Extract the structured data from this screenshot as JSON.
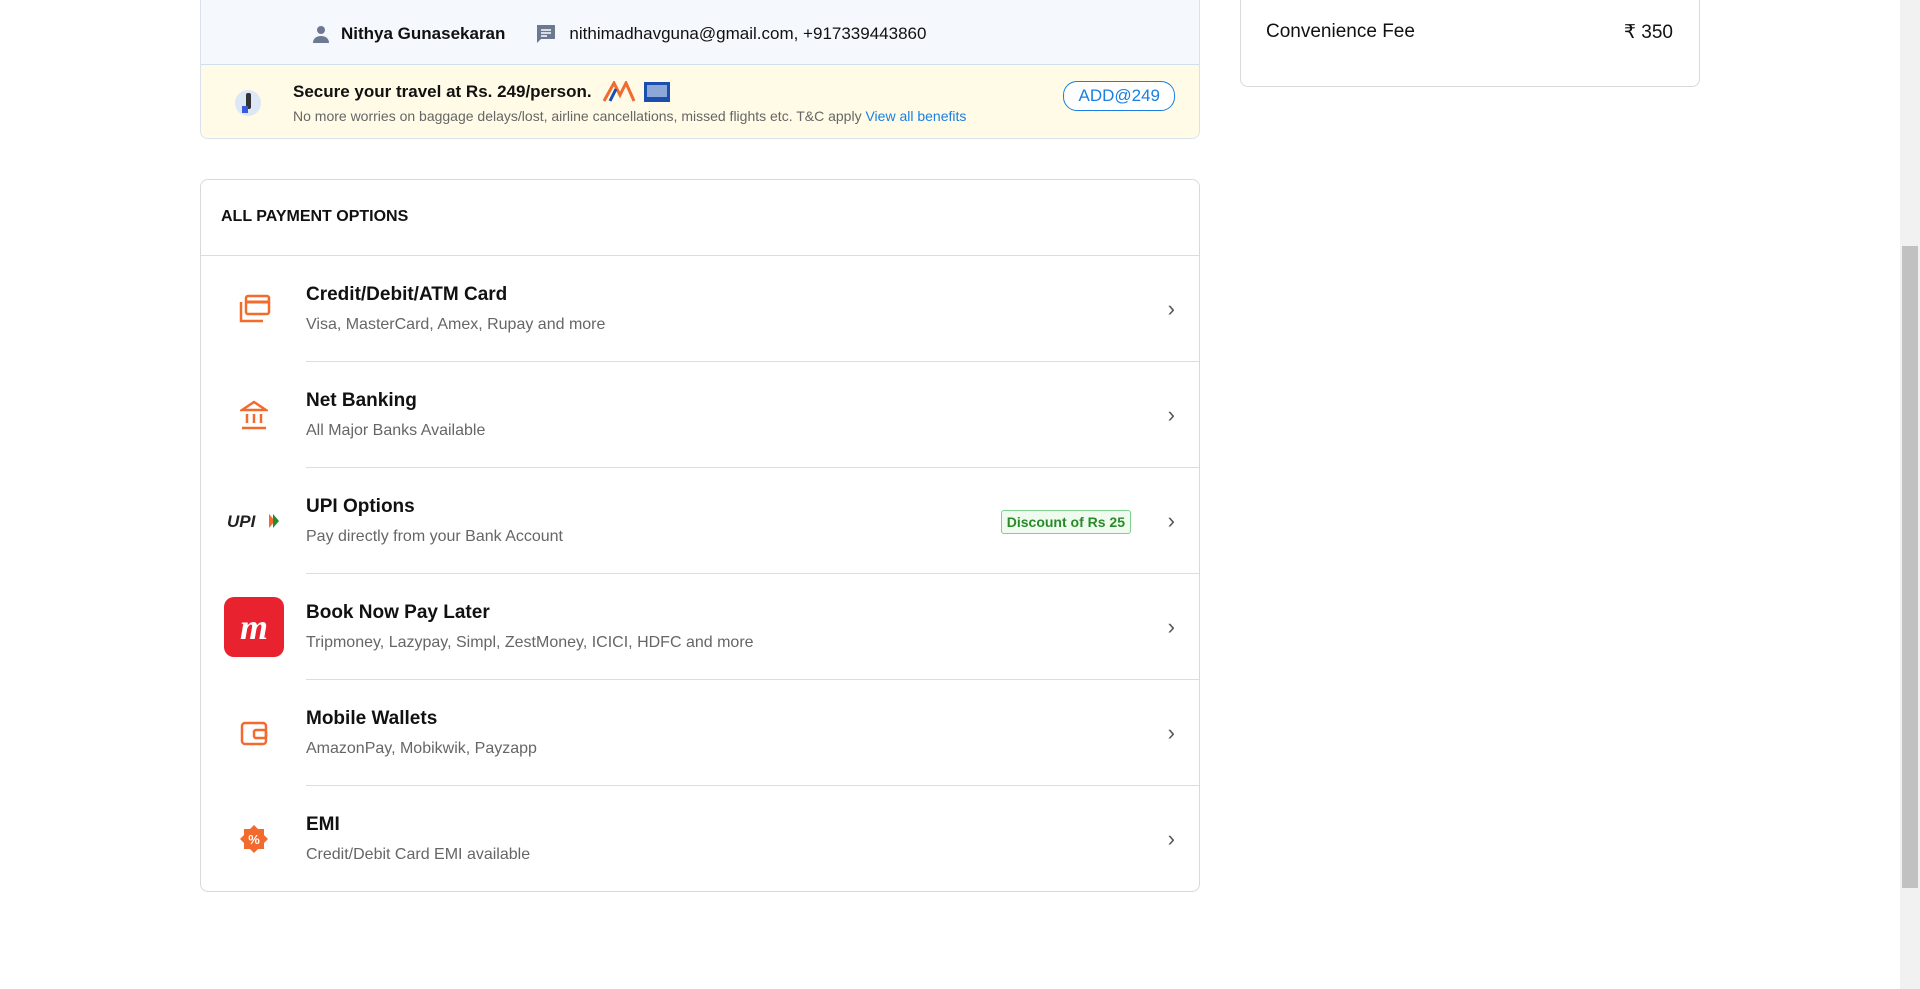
{
  "contact": {
    "name": "Nithya Gunasekaran",
    "details": "nithimadhavguna@gmail.com, +917339443860"
  },
  "insurance": {
    "title": "Secure your travel at Rs. 249/person.",
    "description": "No more worries on baggage delays/lost, airline cancellations, missed flights etc. T&C apply",
    "link": "View all benefits",
    "button": "ADD@249"
  },
  "payment": {
    "heading": "ALL PAYMENT OPTIONS",
    "options": [
      {
        "title": "Credit/Debit/ATM Card",
        "subtitle": "Visa, MasterCard, Amex, Rupay and more",
        "icon": "card-icon"
      },
      {
        "title": "Net Banking",
        "subtitle": "All Major Banks Available",
        "icon": "bank-icon"
      },
      {
        "title": "UPI Options",
        "subtitle": "Pay directly from your Bank Account",
        "icon": "upi-logo",
        "badge": "Discount of Rs 25"
      },
      {
        "title": "Book Now Pay Later",
        "subtitle": "Tripmoney, Lazypay, Simpl, ZestMoney, ICICI, HDFC and more",
        "icon": "tripmoney-logo"
      },
      {
        "title": "Mobile Wallets",
        "subtitle": "AmazonPay, Mobikwik, Payzapp",
        "icon": "wallet-icon"
      },
      {
        "title": "EMI",
        "subtitle": "Credit/Debit Card EMI available",
        "icon": "emi-icon"
      }
    ]
  },
  "fare": {
    "label": "Convenience Fee",
    "value": "₹ 350"
  },
  "colors": {
    "accent": "#f26a2e",
    "link": "#1a7fe0",
    "discount": "#2a8a2a"
  }
}
